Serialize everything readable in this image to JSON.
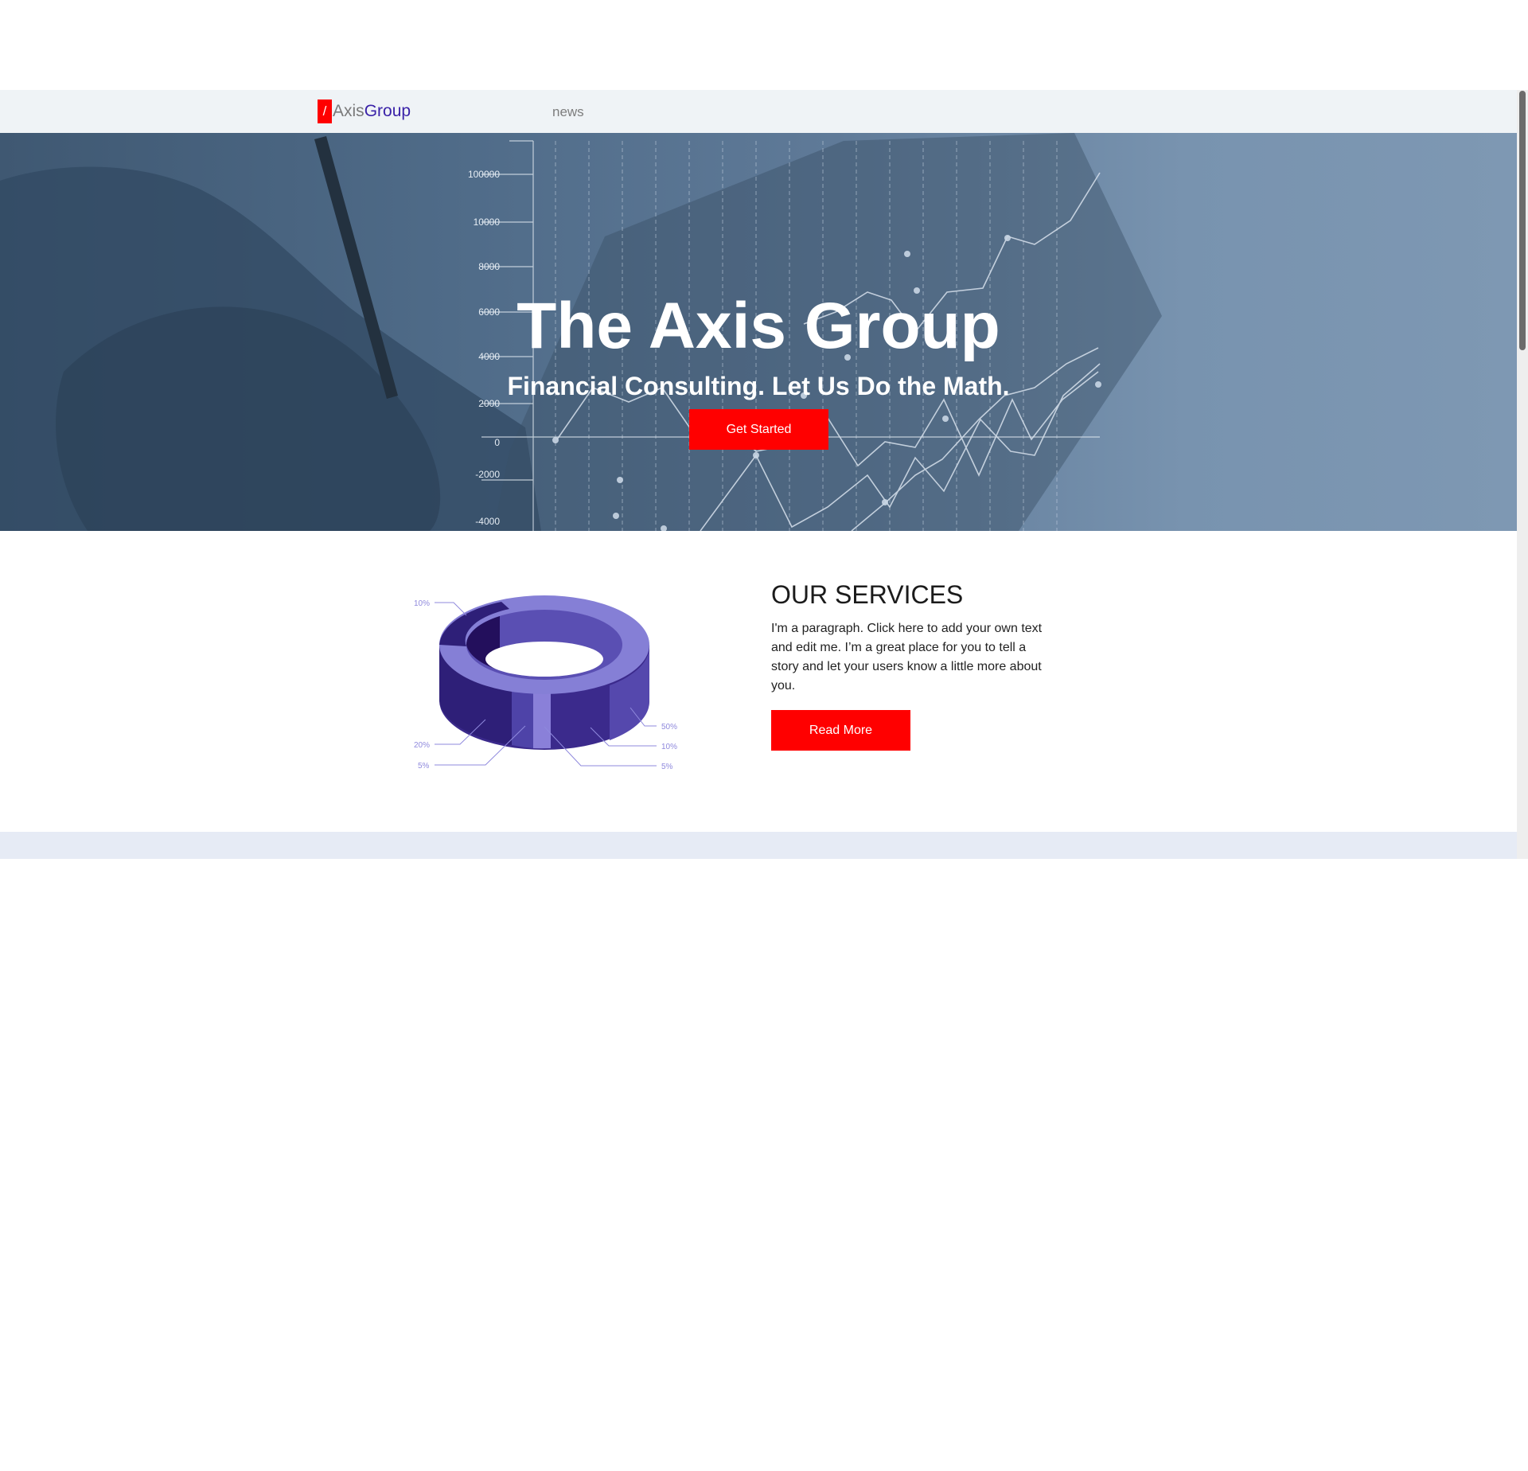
{
  "header": {
    "logo_mark": "/",
    "logo_word_1": "Axis",
    "logo_word_2": "Group",
    "nav_news": "news"
  },
  "hero": {
    "title": "The Axis Group",
    "subtitle": "Financial Consulting. Let Us Do the Math.",
    "cta_label": "Get Started",
    "axis_labels": [
      "100000",
      "10000",
      "8000",
      "6000",
      "4000",
      "2000",
      "0",
      "-2000",
      "-4000"
    ]
  },
  "services": {
    "title": "OUR SERVICES",
    "paragraph": "I'm a paragraph. Click here to add your own text and edit me. I’m a great place for you to tell a story and let your users know a little more about you.",
    "button_label": "Read More",
    "ring_labels": [
      "10%",
      "20%",
      "5%",
      "50%",
      "10%",
      "5%"
    ]
  },
  "colors": {
    "accent": "#ff0000",
    "brand": "#3a22a8",
    "topbar": "#eff3f6",
    "stripe": "#e6ebf5"
  }
}
